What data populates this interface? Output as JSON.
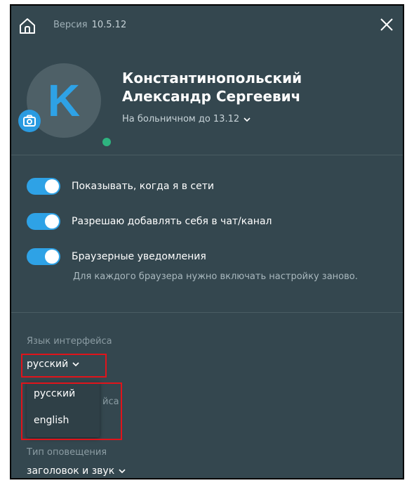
{
  "header": {
    "version_label": "Версия",
    "version_number": "10.5.12"
  },
  "profile": {
    "avatar_letter": "K",
    "name": "Константинопольский Александр Сергеевич",
    "status": "На больничном до 13.12"
  },
  "settings": {
    "toggles": [
      {
        "label": "Показывать, когда я в сети",
        "on": true
      },
      {
        "label": "Разрешаю добавлять себя в чат/канал",
        "on": true
      },
      {
        "label": "Браузерные уведомления",
        "on": true
      }
    ],
    "browser_hint": "Для каждого браузера нужно включать настройку заново."
  },
  "language": {
    "label": "Язык интерфейса",
    "selected": "русский",
    "options": [
      "русский",
      "english"
    ],
    "obscured_text": "йса"
  },
  "notification": {
    "label": "Тип оповещения",
    "selected": "заголовок и звук"
  },
  "colors": {
    "panel_bg": "#34474f",
    "accent": "#2ea2e6",
    "online": "#2eb37f",
    "highlight": "#e0141b"
  },
  "icons": [
    "home-icon",
    "close-icon",
    "camera-icon",
    "chevron-down-icon"
  ]
}
